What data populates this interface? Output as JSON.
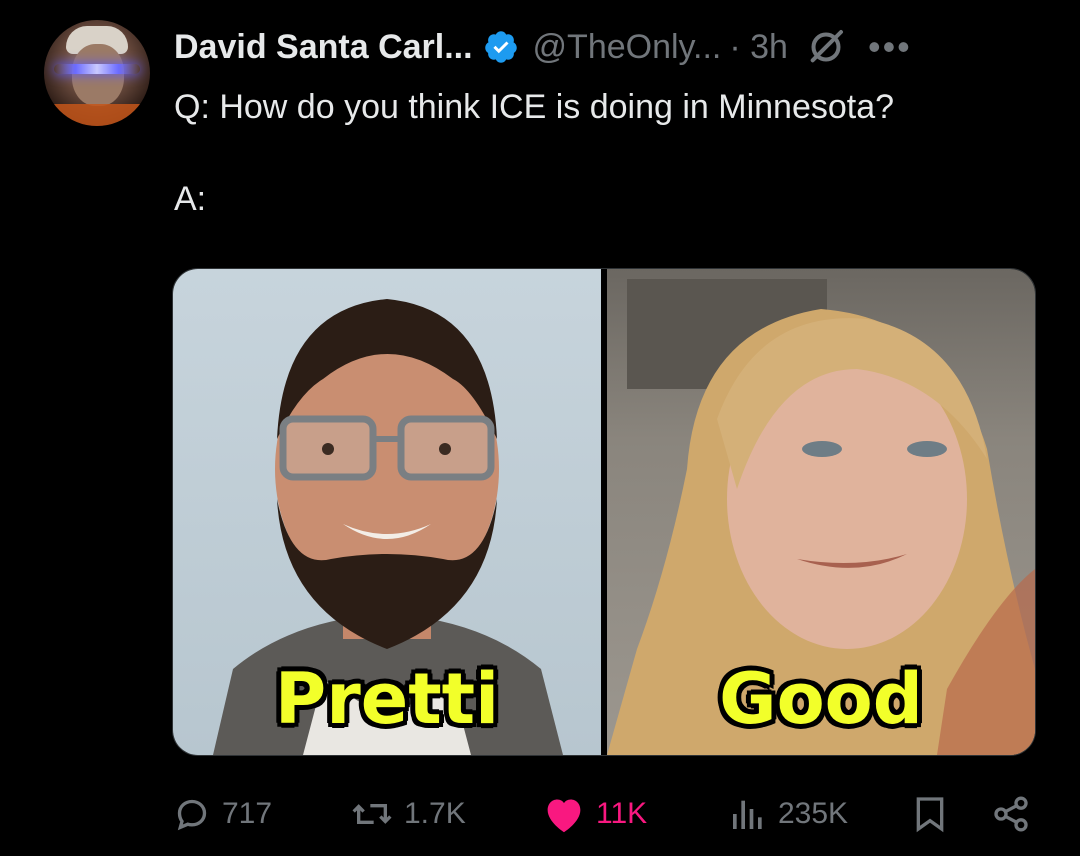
{
  "tweet": {
    "author_name": "David Santa Carl...",
    "author_handle": "@TheOnly...",
    "time": "· 3h",
    "more_label": "•••",
    "text": "Q: How do you think ICE is doing in Minnesota?\n\nA:"
  },
  "media": {
    "left_caption": "Pretti",
    "right_caption": "Good"
  },
  "actions": {
    "replies": "717",
    "reposts": "1.7K",
    "likes": "11K",
    "views": "235K"
  },
  "colors": {
    "background": "#000000",
    "text": "#e7e9ea",
    "muted": "#71767b",
    "verified": "#1d9bf0",
    "like": "#f91880",
    "caption": "#f2ff2a"
  },
  "icons": {
    "verified": "verified-badge-icon",
    "grok": "grok-icon",
    "reply": "reply-icon",
    "repost": "repost-icon",
    "like": "heart-icon",
    "views": "views-icon",
    "bookmark": "bookmark-icon",
    "share": "share-icon"
  }
}
